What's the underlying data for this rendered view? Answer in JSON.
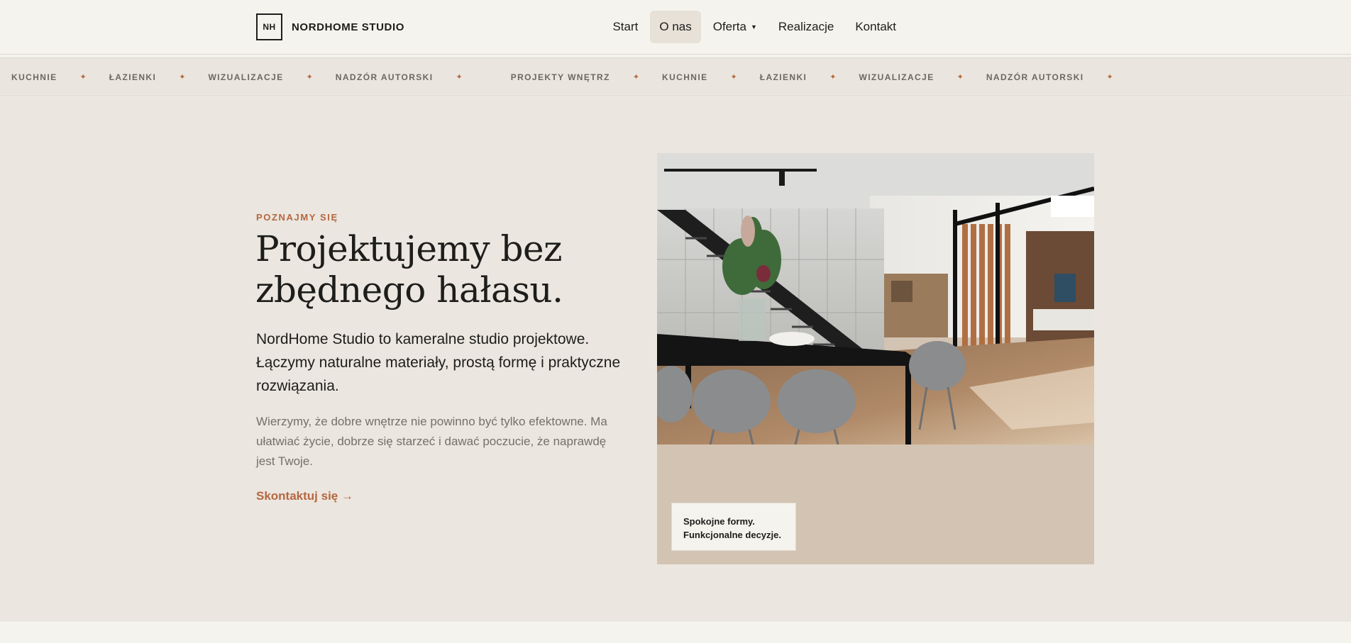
{
  "header": {
    "logo_mark": "NH",
    "logo_text": "NORDHOME STUDIO",
    "nav": [
      {
        "label": "Start"
      },
      {
        "label": "O nas"
      },
      {
        "label": "Oferta"
      },
      {
        "label": "Realizacje"
      },
      {
        "label": "Kontakt"
      }
    ]
  },
  "marquee": {
    "items": [
      "KUCHNIE",
      "ŁAZIENKI",
      "WIZUALIZACJE",
      "NADZÓR AUTORSKI",
      "PROJEKTY WNĘTRZ",
      "KUCHNIE",
      "ŁAZIENKI",
      "WIZUALIZACJE",
      "NADZÓR AUTORSKI"
    ],
    "separator": "✦"
  },
  "hero": {
    "eyebrow": "POZNAJMY SIĘ",
    "title": "Projektujemy bez zbędnego hałasu.",
    "lead": "NordHome Studio to kameralne studio projektowe. Łączymy naturalne materiały, prostą formę i praktyczne rozwiązania.",
    "body": "Wierzymy, że dobre wnętrze nie powinno być tylko efektowne. Ma ułatwiać życie, dobrze się starzeć i dawać poczucie, że naprawdę jest Twoje.",
    "cta": "Skontaktuj się →",
    "caption_line1": "Spokojne formy.",
    "caption_line2": "Funkcjonalne decyzje."
  },
  "colors": {
    "accent": "#b5673f",
    "background": "#ebe6df",
    "header_bg": "#f5f3ee",
    "card_bg": "#d3c3b2",
    "text": "#1d1d1b"
  },
  "icons": {
    "dropdown": "caret-down-icon",
    "separator": "star-icon"
  }
}
